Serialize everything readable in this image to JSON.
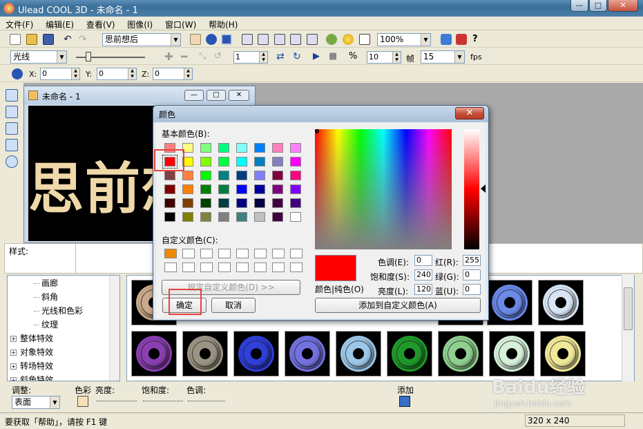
{
  "window": {
    "title": "Ulead COOL 3D - 未命名 - 1"
  },
  "menu": [
    "文件(F)",
    "编辑(E)",
    "查看(V)",
    "图像(I)",
    "窗口(W)",
    "帮助(H)"
  ],
  "toolbar1": {
    "template_select": "思前想后",
    "zoom": "100%"
  },
  "toolbar2": {
    "mode_select": "光线",
    "frame_value": "1",
    "frames": "10",
    "frames_label": "帧",
    "fps_value": "15",
    "fps_label": "fps"
  },
  "toolbar3": {
    "x_label": "X:",
    "x_value": "0",
    "y_label": "Y:",
    "y_value": "0",
    "z_label": "Z:",
    "z_value": "0"
  },
  "document": {
    "title": "未命名 - 1",
    "canvas_text": "思前想"
  },
  "style_panel": {
    "label": "样式:"
  },
  "tree": {
    "items": [
      {
        "label": "画廊",
        "expander": false
      },
      {
        "label": "斜角",
        "expander": false
      },
      {
        "label": "光线和色彩",
        "expander": false
      },
      {
        "label": "纹理",
        "expander": false
      },
      {
        "label": "整体特效",
        "expander": true
      },
      {
        "label": "对象特效",
        "expander": true
      },
      {
        "label": "转场特效",
        "expander": true
      },
      {
        "label": "斜角特效",
        "expander": true
      }
    ]
  },
  "thumbnails": {
    "row1": [
      "#caa98a",
      "#d8c9a0",
      "#6a89e8",
      "#d7e4f4"
    ],
    "row2": [
      "#8a3fb0",
      "#9b9484",
      "#2f3fd8",
      "#7272e0",
      "#9cc7e8",
      "#1f9a2a",
      "#8fcf8f",
      "#d6f0da",
      "#efe897"
    ]
  },
  "bottom": {
    "adjust_label": "调整:",
    "surface_select": "表面",
    "color_label": "色彩",
    "brightness_label": "亮度:",
    "saturation_label": "饱和度:",
    "hue_label": "色调:",
    "add_label": "添加"
  },
  "status": {
    "help_text": "要获取「帮助」，请按 F1 键",
    "size": "320 x 240"
  },
  "watermark": {
    "brand": "Baidu经验",
    "url": "jingyan.baidu.com"
  },
  "color_dialog": {
    "title": "颜色",
    "basic_label": "基本颜色(B):",
    "custom_label": "自定义颜色(C):",
    "define_button": "规定自定义颜色(D) >>",
    "ok_button": "确定",
    "cancel_button": "取消",
    "add_custom_button": "添加到自定义颜色(A)",
    "color_solid_label": "颜色|纯色(O)",
    "hue_label": "色调(E):",
    "hue_value": "0",
    "sat_label": "饱和度(S):",
    "sat_value": "240",
    "lum_label": "亮度(L):",
    "lum_value": "120",
    "red_label": "红(R):",
    "red_value": "255",
    "green_label": "绿(G):",
    "green_value": "0",
    "blue_label": "蓝(U):",
    "blue_value": "0",
    "selected_color": "#ff0000",
    "basic_colors": [
      [
        "#ff8080",
        "#ffff80",
        "#80ff80",
        "#00ff80",
        "#80ffff",
        "#0080ff",
        "#ff80c0",
        "#ff80ff"
      ],
      [
        "#ff0000",
        "#ffff00",
        "#80ff00",
        "#00ff40",
        "#00ffff",
        "#0080c0",
        "#8080c0",
        "#ff00ff"
      ],
      [
        "#804040",
        "#ff8040",
        "#00ff00",
        "#008080",
        "#004080",
        "#8080ff",
        "#800040",
        "#ff0080"
      ],
      [
        "#800000",
        "#ff8000",
        "#008000",
        "#008040",
        "#0000ff",
        "#0000a0",
        "#800080",
        "#8000ff"
      ],
      [
        "#400000",
        "#804000",
        "#004000",
        "#004040",
        "#000080",
        "#000040",
        "#400040",
        "#400080"
      ],
      [
        "#000000",
        "#808000",
        "#808040",
        "#808080",
        "#408080",
        "#c0c0c0",
        "#400040",
        "#ffffff"
      ]
    ],
    "custom_colors": [
      "#f08a00",
      "#ffffff",
      "#ffffff",
      "#ffffff",
      "#ffffff",
      "#ffffff",
      "#ffffff",
      "#ffffff",
      "#ffffff",
      "#ffffff",
      "#ffffff",
      "#ffffff",
      "#ffffff",
      "#ffffff",
      "#ffffff",
      "#ffffff"
    ]
  }
}
